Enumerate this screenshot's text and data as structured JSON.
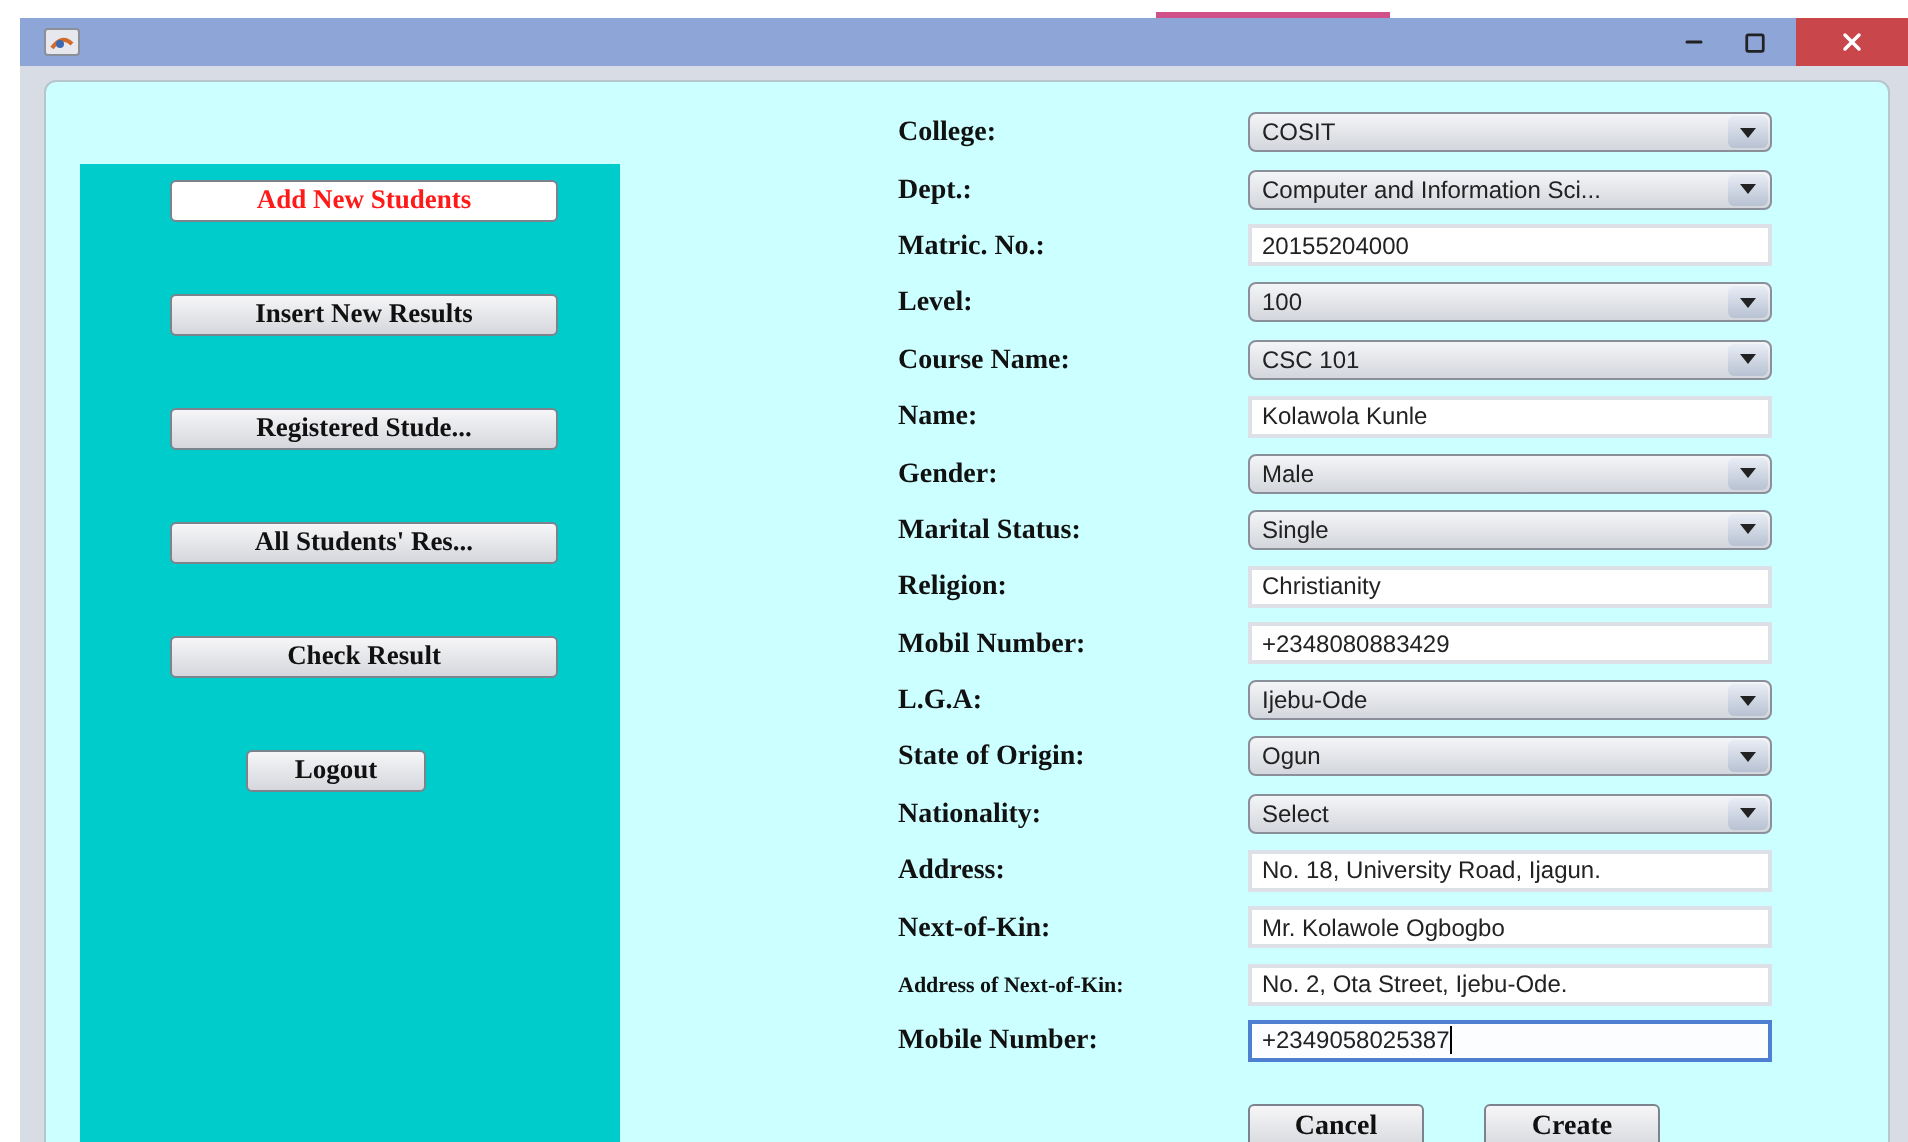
{
  "sidebar": {
    "buttons": [
      {
        "label": "Add New Students",
        "selected": true,
        "kind": "wide"
      },
      {
        "label": "Insert New Results",
        "selected": false,
        "kind": "wide"
      },
      {
        "label": "Registered Stude...",
        "selected": false,
        "kind": "wide"
      },
      {
        "label": "All Students' Res...",
        "selected": false,
        "kind": "wide"
      },
      {
        "label": "Check Result",
        "selected": false,
        "kind": "wide"
      },
      {
        "label": "Logout",
        "selected": false,
        "kind": "narrow"
      }
    ]
  },
  "form": {
    "fields": [
      {
        "label": "College:",
        "kind": "combo",
        "value": "COSIT",
        "focused": false
      },
      {
        "label": "Dept.:",
        "kind": "combo",
        "value": "Computer and Information Sci...",
        "focused": false
      },
      {
        "label": "Matric. No.:",
        "kind": "text",
        "value": "20155204000",
        "focused": false
      },
      {
        "label": "Level:",
        "kind": "combo",
        "value": "100",
        "focused": false
      },
      {
        "label": "Course Name:",
        "kind": "combo",
        "value": "CSC 101",
        "focused": false
      },
      {
        "label": "Name:",
        "kind": "text",
        "value": "Kolawola Kunle",
        "focused": false
      },
      {
        "label": "Gender:",
        "kind": "combo",
        "value": "Male",
        "focused": false
      },
      {
        "label": "Marital Status:",
        "kind": "combo",
        "value": "Single",
        "focused": false
      },
      {
        "label": "Religion:",
        "kind": "text",
        "value": "Christianity",
        "focused": false
      },
      {
        "label": "Mobil Number:",
        "kind": "text",
        "value": "+2348080883429",
        "focused": false
      },
      {
        "label": "L.G.A:",
        "kind": "combo",
        "value": "Ijebu-Ode",
        "focused": false
      },
      {
        "label": "State of Origin:",
        "kind": "combo",
        "value": "Ogun",
        "focused": false
      },
      {
        "label": "Nationality:",
        "kind": "combo",
        "value": "Select",
        "focused": false
      },
      {
        "label": "Address:",
        "kind": "text",
        "value": "No. 18, University Road, Ijagun.",
        "focused": false
      },
      {
        "label": "Next-of-Kin:",
        "kind": "text",
        "value": "Mr. Kolawole Ogbogbo",
        "focused": false
      },
      {
        "label": "Address of Next-of-Kin:",
        "kind": "text",
        "value": "No. 2, Ota Street, Ijebu-Ode.",
        "focused": false,
        "small_label": true
      },
      {
        "label": "Mobile Number:",
        "kind": "text",
        "value": "+2349058025387",
        "focused": true
      }
    ],
    "buttons": [
      "Cancel",
      "Create"
    ]
  }
}
